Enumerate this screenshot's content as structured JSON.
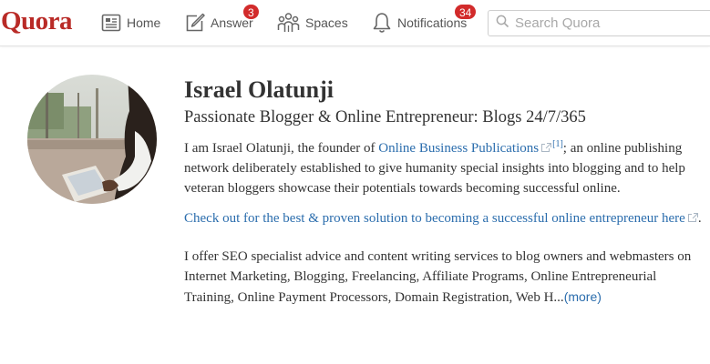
{
  "header": {
    "logo": "Quora",
    "nav": {
      "home": "Home",
      "answer": "Answer",
      "spaces": "Spaces",
      "notifications": "Notifications"
    },
    "badges": {
      "answer": "3",
      "notifications": "34"
    },
    "search_placeholder": "Search Quora",
    "brand_color": "#b92b27",
    "badge_color": "#d22b2b"
  },
  "profile": {
    "name": "Israel Olatunji",
    "tagline": "Passionate Blogger & Online Entrepreneur: Blogs 24/7/365",
    "bio": {
      "p1_prefix": "I am Israel Olatunji, the founder of ",
      "p1_link": "Online Business Publications",
      "p1_ref": "[1]",
      "p1_suffix": "; an online publishing network deliberately established to give humanity special insights into blogging and to help veteran bloggers showcase their potentials towards becoming successful online.",
      "p2_link": "Check out for the best & proven solution to becoming a successful online entrepreneur here",
      "p2_suffix": ".",
      "p3": "I offer SEO specialist advice and content writing services to blog owners and webmasters on Internet Marketing, Blogging, Freelancing, Affiliate Programs, Online Entrepreneurial Training, Online Payment Processors, Domain Registration, Web H...",
      "more": "(more)"
    },
    "link_color": "#2b6dad",
    "avatar_icon": "profile-photo"
  }
}
